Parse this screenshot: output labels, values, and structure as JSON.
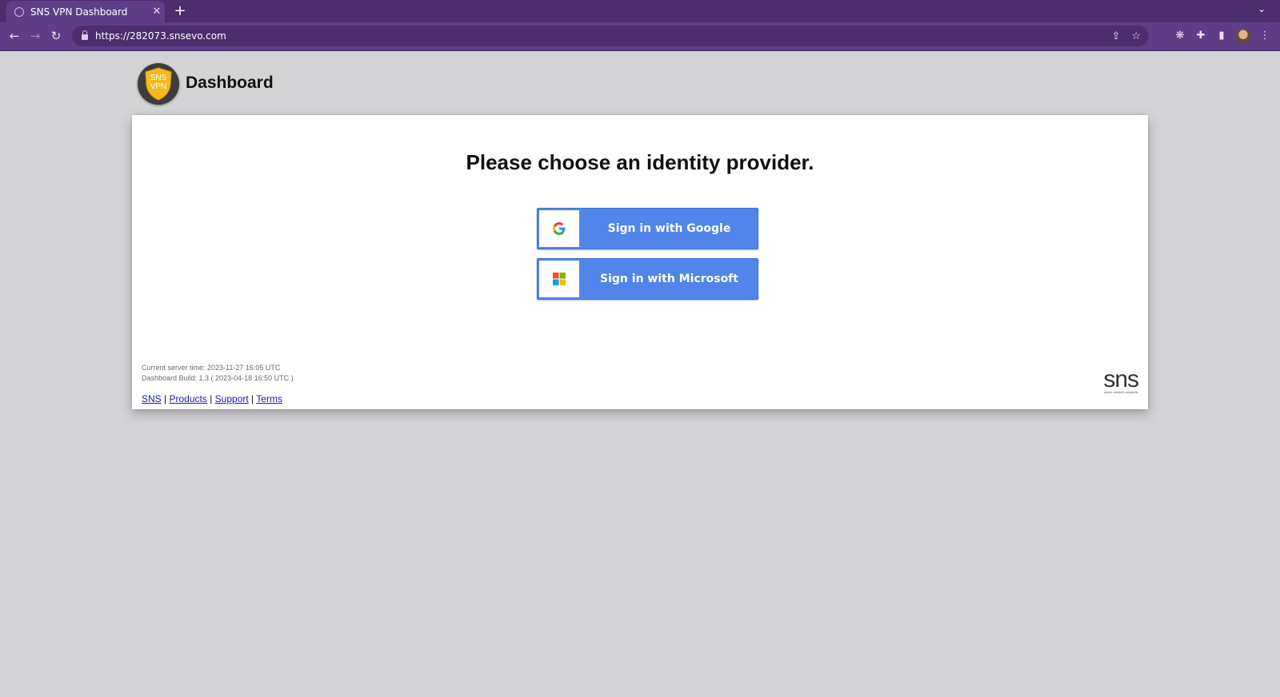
{
  "browser": {
    "tab_title": "SNS VPN Dashboard",
    "tab_close": "✕",
    "new_tab": "+",
    "tab_menu": "⌄",
    "url": "https://282073.snsevo.com",
    "back": "←",
    "forward": "→",
    "reload": "↻",
    "share": "⇪",
    "bookmark": "☆",
    "extension_a": "❋",
    "extensions": "✚",
    "sidepanel": "▮",
    "menu": "⋮"
  },
  "header": {
    "logo_top": "SNS",
    "logo_bottom": "VPN",
    "title": "Dashboard"
  },
  "main": {
    "heading": "Please choose an identity provider.",
    "google_label": "Sign in with Google",
    "microsoft_label": "Sign in with Microsoft"
  },
  "footer": {
    "server_time": "Current server time: 2023-11-27 16:05 UTC",
    "build": "Dashboard Build: 1.3 ( 2023-04-18 16:50 UTC )",
    "links": {
      "sns": "SNS",
      "products": "Products",
      "support": "Support",
      "terms": "Terms",
      "separator": "|"
    },
    "brand_word": "SNS",
    "brand_tagline": "studio network solutions"
  },
  "colors": {
    "browser_frame": "#4a2e6e",
    "toolbar": "#5e3f87",
    "page_background": "#d4d3d5",
    "button_blue": "#5185e9",
    "logo_shield": "#f5b81f"
  },
  "icons": {
    "google": "google-g-icon",
    "microsoft": "microsoft-four-squares-icon"
  }
}
